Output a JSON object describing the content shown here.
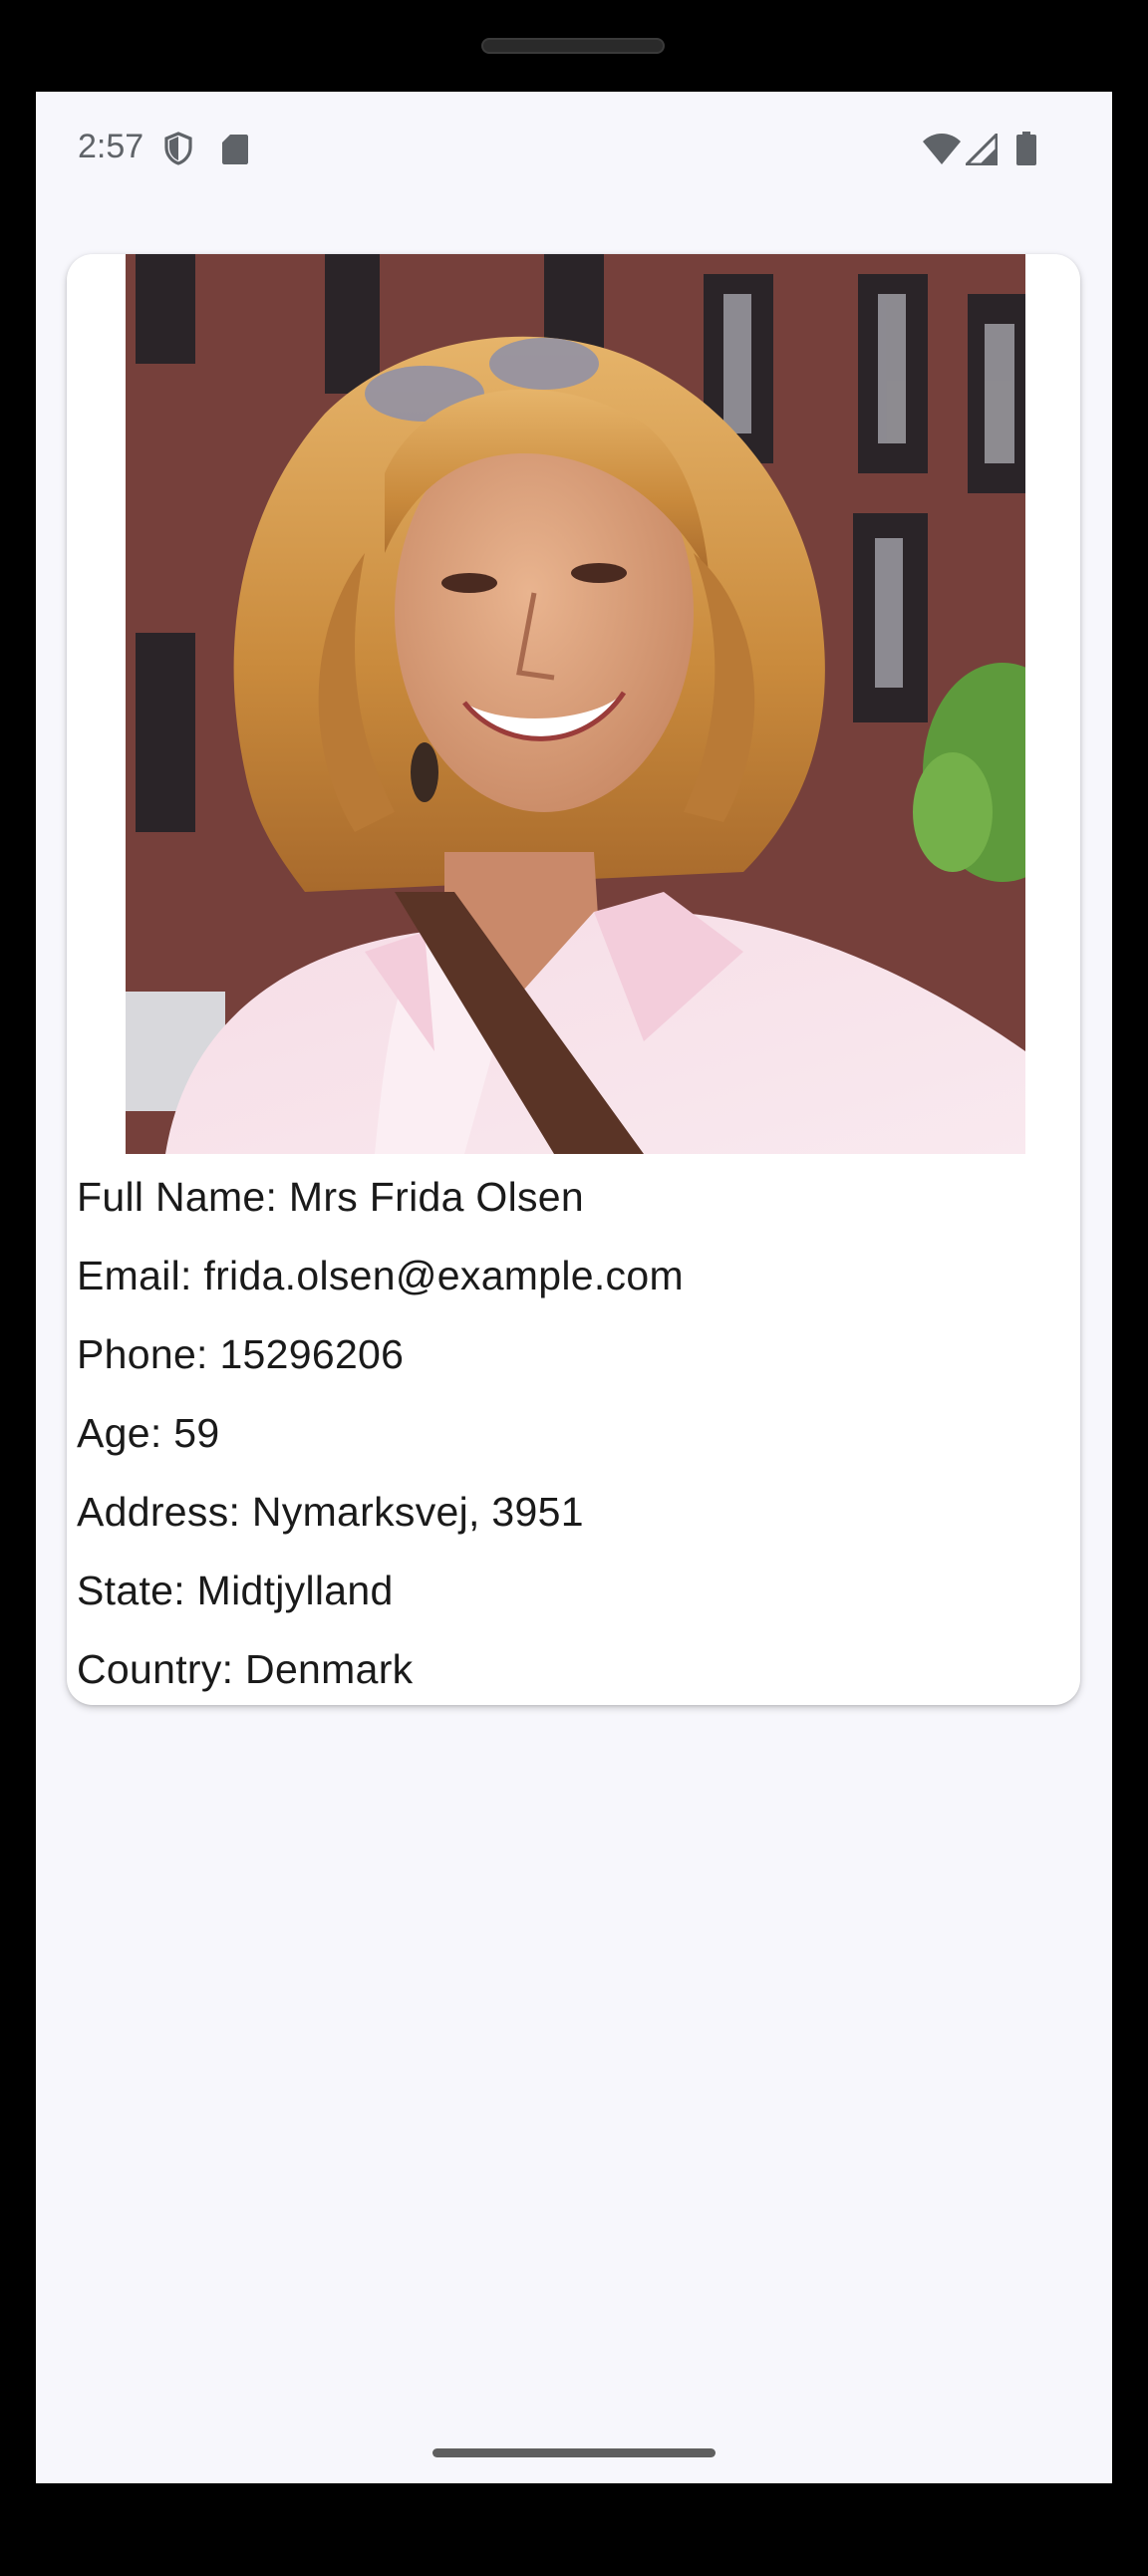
{
  "status_bar": {
    "time": "2:57",
    "left_icons": [
      "shield-icon",
      "sd-card-icon"
    ],
    "right_icons": [
      "wifi-icon",
      "cellular-signal-icon",
      "battery-icon"
    ]
  },
  "profile": {
    "photo_alt": "profile-photo",
    "lines": [
      "Full Name: Mrs Frida Olsen",
      "Email: frida.olsen@example.com",
      "Phone: 15296206",
      "Age: 59",
      "Address: Nymarksvej, 3951",
      "State: Midtjylland",
      "Country: Denmark"
    ]
  },
  "colors": {
    "screen_background": "#f7f7fc",
    "card_background": "#ffffff",
    "text": "#1a1a1a",
    "status_text": "#5f6368"
  }
}
